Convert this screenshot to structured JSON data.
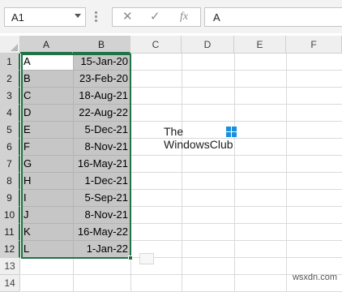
{
  "formula_bar": {
    "name_box": "A1",
    "cancel_icon": "✕",
    "enter_icon": "✓",
    "function_icon": "fx",
    "formula_value": "A"
  },
  "columns": [
    "A",
    "B",
    "C",
    "D",
    "E",
    "F"
  ],
  "rows": [
    "1",
    "2",
    "3",
    "4",
    "5",
    "6",
    "7",
    "8",
    "9",
    "10",
    "11",
    "12",
    "13",
    "14"
  ],
  "cells": [
    {
      "a": "A",
      "b": "15-Jan-20"
    },
    {
      "a": "B",
      "b": "23-Feb-20"
    },
    {
      "a": "C",
      "b": "18-Aug-21"
    },
    {
      "a": "D",
      "b": "22-Aug-22"
    },
    {
      "a": "E",
      "b": "5-Dec-21"
    },
    {
      "a": "F",
      "b": "8-Nov-21"
    },
    {
      "a": "G",
      "b": "16-May-21"
    },
    {
      "a": "H",
      "b": "1-Dec-21"
    },
    {
      "a": "I",
      "b": "5-Sep-21"
    },
    {
      "a": "J",
      "b": "8-Nov-21"
    },
    {
      "a": "K",
      "b": "16-May-22"
    },
    {
      "a": "L",
      "b": "1-Jan-22"
    }
  ],
  "logo": {
    "line1": "The",
    "line2": "WindowsClub"
  },
  "watermark": "wsxdn.com",
  "colors": {
    "accent": "#217346",
    "selection": "#c6c6c6",
    "logo_blue": "#1a8fe0"
  }
}
